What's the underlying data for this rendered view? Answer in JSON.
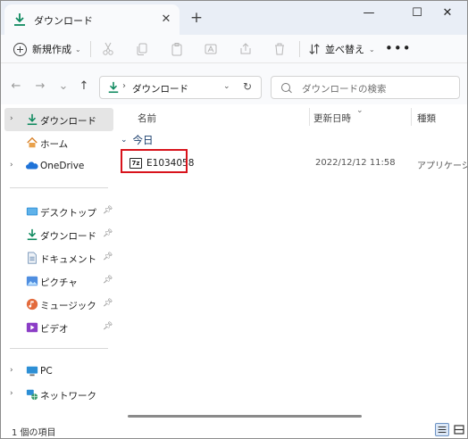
{
  "window": {
    "tab_title": "ダウンロード",
    "close_tab": "✕",
    "new_tab": "+"
  },
  "window_controls": {
    "minimize": "—",
    "maximize": "☐",
    "close": "✕"
  },
  "toolbar": {
    "new_label": "新規作成",
    "sort_label": "並べ替え",
    "more_label": "•••"
  },
  "address": {
    "path": "ダウンロード",
    "search_placeholder": "ダウンロードの検索"
  },
  "sidebar": {
    "quick": [
      {
        "label": "ダウンロード",
        "icon": "download-icon",
        "selected": true
      },
      {
        "label": "ホーム",
        "icon": "home-icon"
      },
      {
        "label": "OneDrive",
        "icon": "onedrive-icon"
      }
    ],
    "pinned": [
      {
        "label": "デスクトップ",
        "icon": "desktop-icon"
      },
      {
        "label": "ダウンロード",
        "icon": "download-icon"
      },
      {
        "label": "ドキュメント",
        "icon": "documents-icon"
      },
      {
        "label": "ピクチャ",
        "icon": "pictures-icon"
      },
      {
        "label": "ミュージック",
        "icon": "music-icon"
      },
      {
        "label": "ビデオ",
        "icon": "video-icon"
      }
    ],
    "devices": [
      {
        "label": "PC",
        "icon": "pc-icon"
      },
      {
        "label": "ネットワーク",
        "icon": "network-icon"
      }
    ]
  },
  "columns": {
    "name": "名前",
    "modified": "更新日時",
    "type": "種類"
  },
  "group": {
    "label": "今日"
  },
  "files": [
    {
      "name": "E1034058",
      "modified": "2022/12/12 11:58",
      "type": "アプリケーション"
    }
  ],
  "status": {
    "count": "1 個の項目"
  },
  "colors": {
    "accent": "#0f8a5f",
    "highlight": "#d8131c",
    "onedrive": "#1f73d8"
  }
}
